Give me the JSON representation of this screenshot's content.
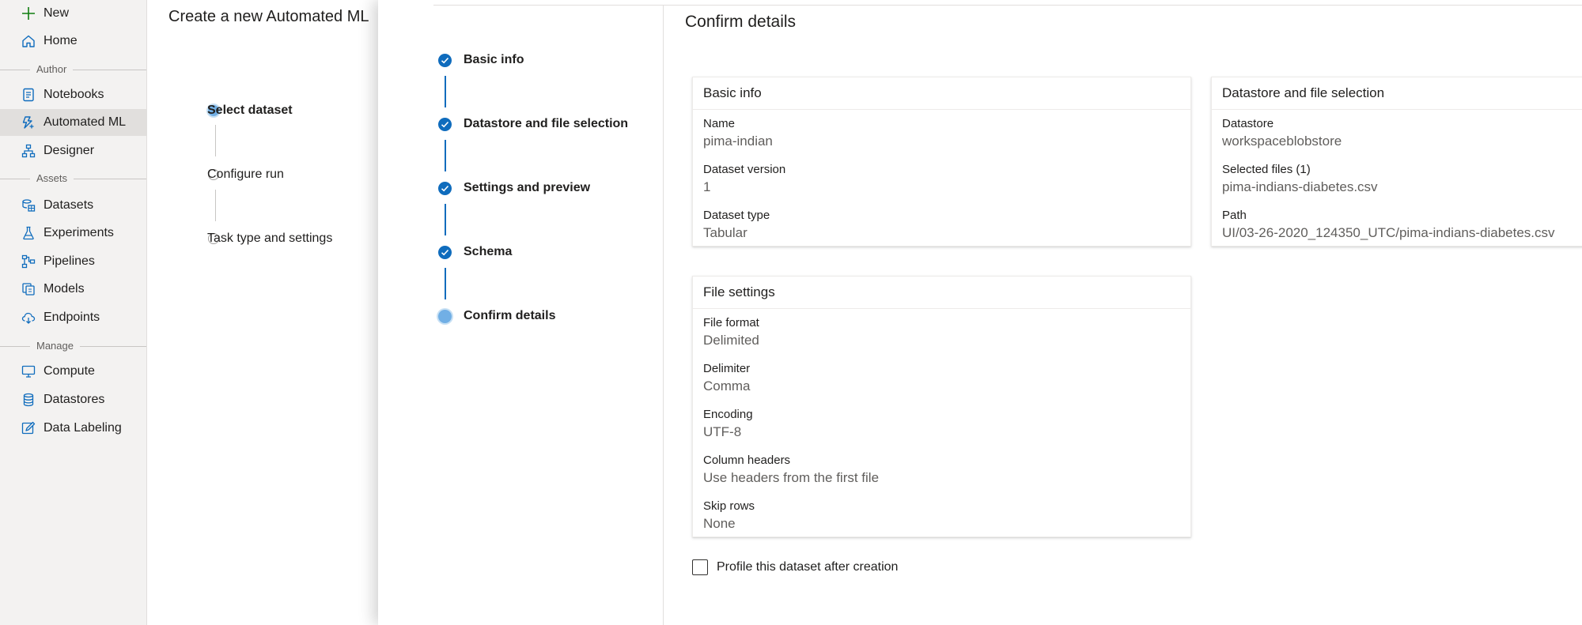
{
  "sidebar": {
    "new_label": "New",
    "home_label": "Home",
    "section_author": "Author",
    "author_items": [
      "Notebooks",
      "Automated ML",
      "Designer"
    ],
    "section_assets": "Assets",
    "asset_items": [
      "Datasets",
      "Experiments",
      "Pipelines",
      "Models",
      "Endpoints"
    ],
    "section_manage": "Manage",
    "manage_items": [
      "Compute",
      "Datastores",
      "Data Labeling"
    ],
    "selected_item": "Automated ML",
    "icon_color": "#0f6cbd",
    "new_icon_color": "#107c10"
  },
  "background_page": {
    "title": "Create a new Automated ML",
    "steps": [
      "Select dataset",
      "Configure run",
      "Task type and settings"
    ],
    "active_step": "Select dataset"
  },
  "wizard": {
    "steps": [
      "Basic info",
      "Datastore and file selection",
      "Settings and preview",
      "Schema",
      "Confirm details"
    ],
    "current_step": "Confirm details",
    "completed_color": "#0f6cbd"
  },
  "confirm": {
    "heading": "Confirm details",
    "basic_info": {
      "title": "Basic info",
      "name_label": "Name",
      "name_value": "pima-indian",
      "version_label": "Dataset version",
      "version_value": "1",
      "type_label": "Dataset type",
      "type_value": "Tabular"
    },
    "datastore": {
      "title": "Datastore and file selection",
      "datastore_label": "Datastore",
      "datastore_value": "workspaceblobstore",
      "files_label": "Selected files (1)",
      "files_value": "pima-indians-diabetes.csv",
      "path_label": "Path",
      "path_value": "UI/03-26-2020_124350_UTC/pima-indians-diabetes.csv"
    },
    "file_settings": {
      "title": "File settings",
      "format_label": "File format",
      "format_value": "Delimited",
      "delimiter_label": "Delimiter",
      "delimiter_value": "Comma",
      "encoding_label": "Encoding",
      "encoding_value": "UTF-8",
      "headers_label": "Column headers",
      "headers_value": "Use headers from the first file",
      "skip_label": "Skip rows",
      "skip_value": "None"
    },
    "profile_checkbox": {
      "label": "Profile this dataset after creation",
      "checked": false
    }
  }
}
